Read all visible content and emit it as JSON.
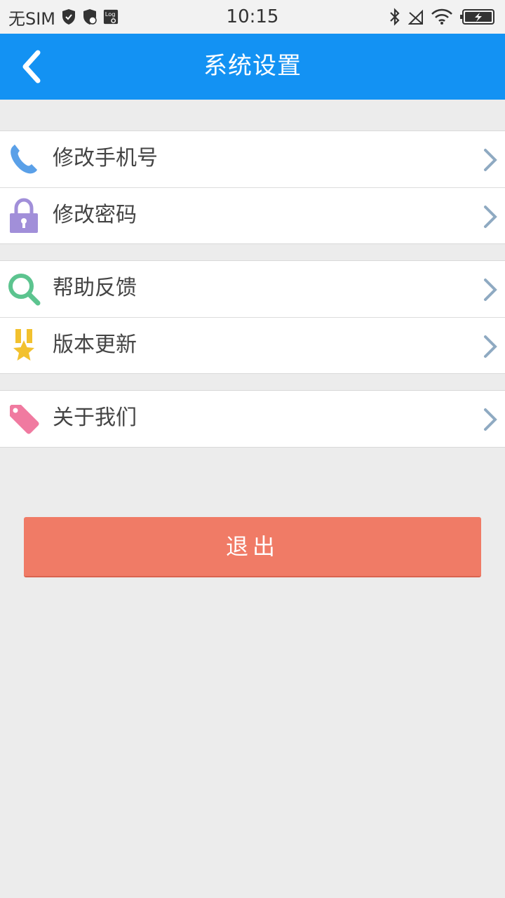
{
  "status_bar": {
    "carrier": "无SIM",
    "time": "10:15"
  },
  "header": {
    "title": "系统设置"
  },
  "groups": [
    {
      "items": [
        {
          "label": "修改手机号",
          "icon": "phone-icon",
          "icon_color": "#5aa0e8"
        },
        {
          "label": "修改密码",
          "icon": "lock-icon",
          "icon_color": "#a18fd9"
        }
      ]
    },
    {
      "items": [
        {
          "label": "帮助反馈",
          "icon": "search-icon",
          "icon_color": "#5cc48f"
        },
        {
          "label": "版本更新",
          "icon": "medal-icon",
          "icon_color": "#f2c12e"
        }
      ]
    },
    {
      "items": [
        {
          "label": "关于我们",
          "icon": "tag-icon",
          "icon_color": "#f07aa0"
        }
      ]
    }
  ],
  "logout": {
    "label": "退出"
  },
  "colors": {
    "header": "#1392f3",
    "logout": "#f07b66",
    "background": "#ececec",
    "chevron": "#8faac2"
  }
}
